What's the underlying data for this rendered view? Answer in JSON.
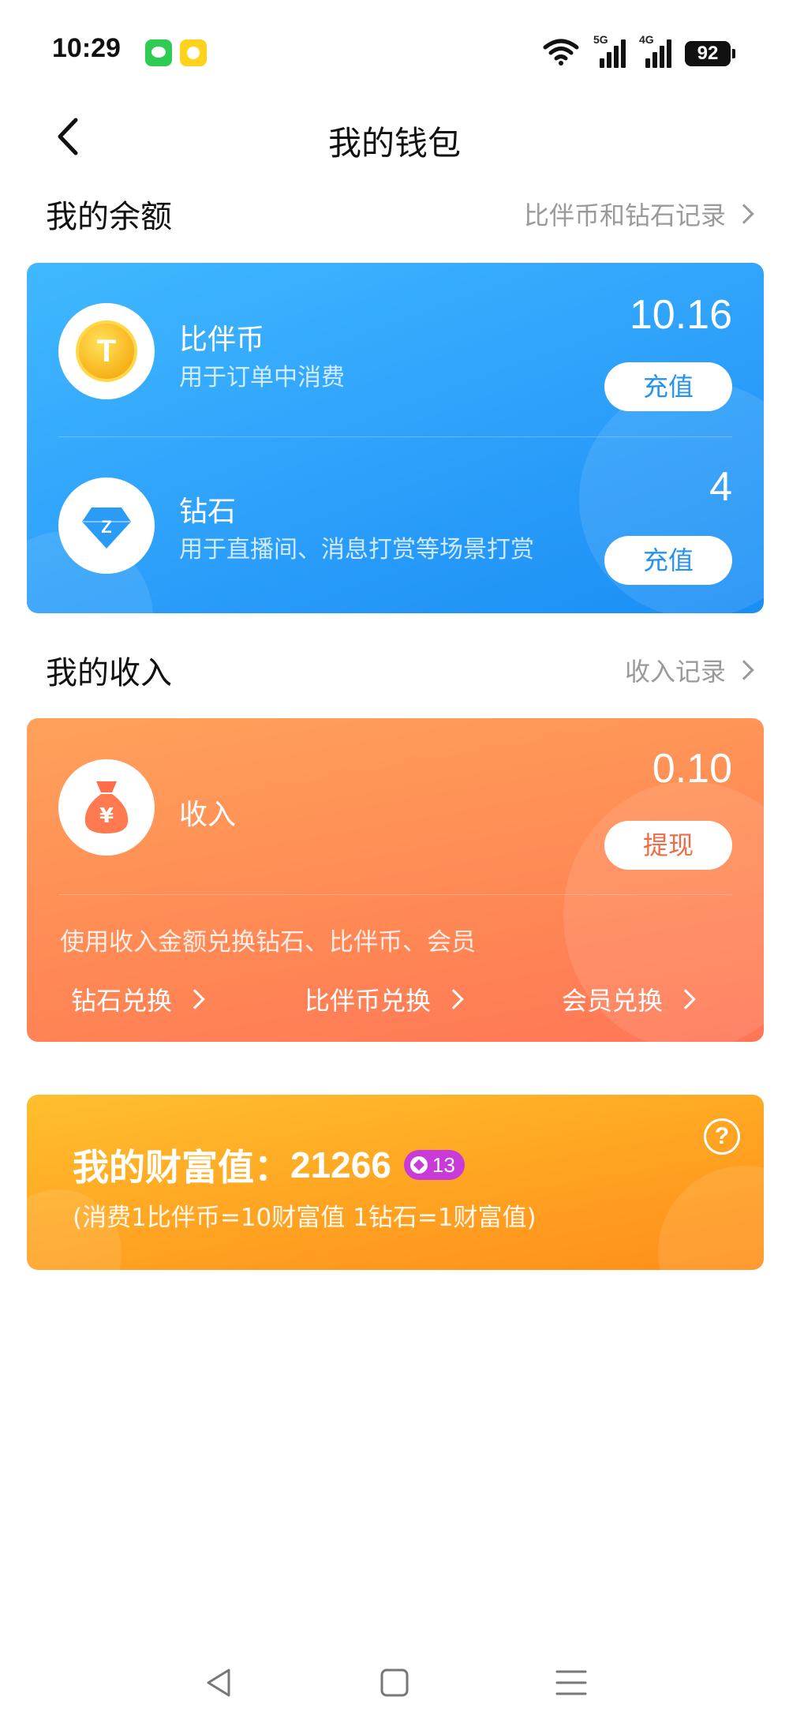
{
  "status_bar": {
    "time": "10:29",
    "app_icons": [
      "wechat-icon",
      "app-notification-icon"
    ],
    "network_1": "5G",
    "network_2": "4G",
    "battery": "92"
  },
  "header": {
    "title": "我的钱包"
  },
  "balance_section": {
    "title": "我的余额",
    "link": "比伴币和钻石记录",
    "items": [
      {
        "name": "比伴币",
        "desc": "用于订单中消费",
        "amount": "10.16",
        "button": "充值",
        "icon": "coin-icon",
        "icon_letter": "T"
      },
      {
        "name": "钻石",
        "desc": "用于直播间、消息打赏等场景打赏",
        "amount": "4",
        "button": "充值",
        "icon": "diamond-icon",
        "icon_letter": "Z"
      }
    ]
  },
  "income_section": {
    "title": "我的收入",
    "link": "收入记录",
    "item": {
      "name": "收入",
      "amount": "0.10",
      "button": "提现",
      "icon": "money-bag-icon",
      "icon_letter": "¥"
    },
    "note": "使用收入金额兑换钻石、比伴币、会员",
    "exchanges": [
      "钻石兑换",
      "比伴币兑换",
      "会员兑换"
    ]
  },
  "wealth": {
    "title_label": "我的财富值：",
    "value": "21266",
    "level": "13",
    "note": "(消费1比伴币=10财富值 1钻石=1财富值)",
    "help_symbol": "?"
  },
  "colors": {
    "balance_card": "#2fa2fb",
    "income_card": "#ff8a55",
    "wealth_card": "#ffa322",
    "blue_button_text": "#2592ee",
    "orange_button_text": "#f06a45",
    "level_badge": "#c93ad8"
  }
}
